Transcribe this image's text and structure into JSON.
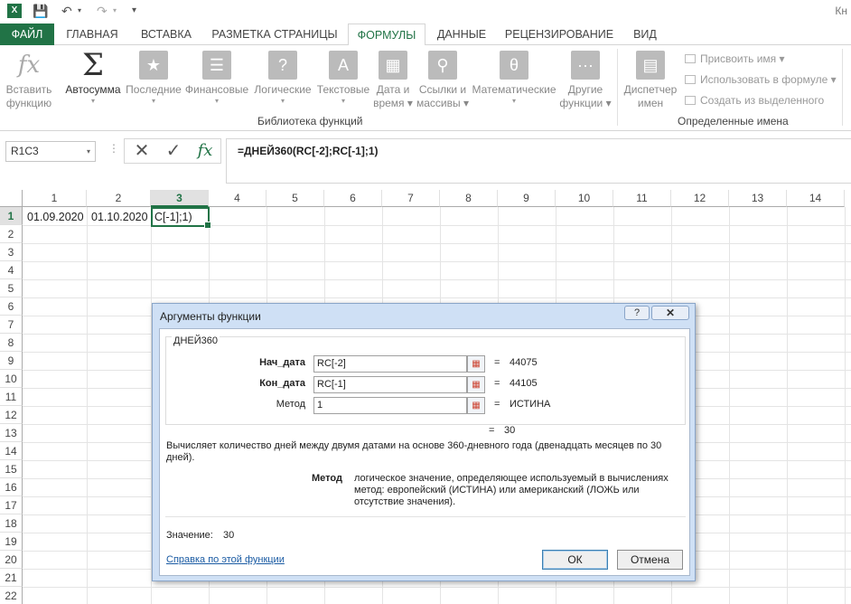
{
  "app": {
    "title_partial": "Кн"
  },
  "qat": {
    "save_icon": "save-icon",
    "undo_icon": "undo-icon",
    "redo_icon": "redo-icon"
  },
  "tabs": [
    {
      "label": "ФАЙЛ"
    },
    {
      "label": "ГЛАВНАЯ"
    },
    {
      "label": "ВСТАВКА"
    },
    {
      "label": "РАЗМЕТКА СТРАНИЦЫ"
    },
    {
      "label": "ФОРМУЛЫ"
    },
    {
      "label": "ДАННЫЕ"
    },
    {
      "label": "РЕЦЕНЗИРОВАНИЕ"
    },
    {
      "label": "ВИД"
    }
  ],
  "ribbon": {
    "insert_function": [
      "Вставить",
      "функцию"
    ],
    "autosum": "Автосумма",
    "recent": "Последние",
    "financial": "Финансовые",
    "logical": "Логические",
    "text": "Текстовые",
    "datetime": [
      "Дата и",
      "время"
    ],
    "lookup": [
      "Ссылки и",
      "массивы"
    ],
    "math": "Математические",
    "more": [
      "Другие",
      "функции"
    ],
    "group_library": "Библиотека функций",
    "name_manager": [
      "Диспетчер",
      "имен"
    ],
    "define_name": "Присвоить имя",
    "use_in_formula": "Использовать в формуле",
    "create_from_selection": "Создать из выделенного",
    "group_names": "Определенные имена"
  },
  "formula_bar": {
    "name_box": "R1C3",
    "formula": "=ДНЕЙ360(RC[-2];RC[-1];1)"
  },
  "grid": {
    "columns": [
      "1",
      "2",
      "3",
      "4",
      "5",
      "6",
      "7",
      "8",
      "9",
      "10",
      "11",
      "12",
      "13",
      "14"
    ],
    "rows": [
      "1",
      "2",
      "3",
      "4",
      "5",
      "6",
      "7",
      "8",
      "9",
      "10",
      "11",
      "12",
      "13",
      "14",
      "15",
      "16",
      "17",
      "18",
      "19",
      "20",
      "21",
      "22"
    ],
    "cells": {
      "r1c1": "01.09.2020",
      "r1c2": "01.10.2020",
      "r1c3": "C[-1];1)"
    }
  },
  "dialog": {
    "title": "Аргументы функции",
    "help_btn": "?",
    "close_btn": "✕",
    "function_name": "ДНЕЙ360",
    "args": [
      {
        "label": "Нач_дата",
        "value": "RC[-2]",
        "eq": "=",
        "result": "44075"
      },
      {
        "label": "Кон_дата",
        "value": "RC[-1]",
        "eq": "=",
        "result": "44105"
      },
      {
        "label": "Метод",
        "value": "1",
        "eq": "=",
        "result": "ИСТИНА"
      }
    ],
    "overall_eq": "=",
    "overall_result": "30",
    "description_1": "Вычисляет количество дней между двумя датами на основе 360-дневного года (двенадцать месяцев по 30",
    "description_2": "дней).",
    "arg_name": "Метод",
    "arg_desc_1": "логическое значение, определяющее используемый в вычислениях",
    "arg_desc_2": "метод: европейский (ИСТИНА) или американский (ЛОЖЬ или",
    "arg_desc_3": "отсутствие значения).",
    "value_label": "Значение:",
    "value": "30",
    "help_link": "Справка по этой функции",
    "ok": "ОК",
    "cancel": "Отмена"
  }
}
